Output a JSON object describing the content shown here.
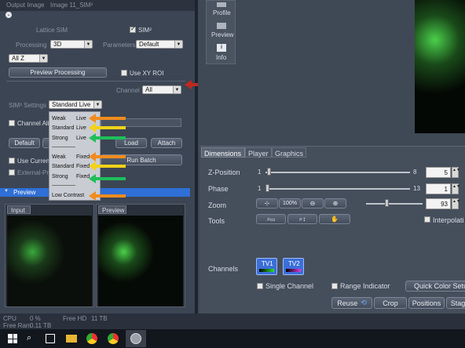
{
  "left_panel": {
    "output_image_label": "Output Image",
    "output_image_value": "Image 11_SIM²",
    "lattice_sim_label": "Lattice SIM",
    "sim2_check_label": "SIM²",
    "processing_label": "Processing",
    "processing_value": "3D",
    "parameters_label": "Parameters",
    "parameters_value": "Default",
    "z_select_value": "All Z",
    "preview_processing_button": "Preview Processing",
    "use_xy_roi_label": "Use XY ROI",
    "channel_label": "Channel",
    "channel_value": "All",
    "sim2_settings_label": "SIM² Settings",
    "sim2_settings_value": "Standard Live",
    "channel_align_label": "Channel Alig",
    "default_button": "Default",
    "load_button": "Load",
    "attach_button": "Attach",
    "use_current_label": "Use Current S",
    "run_batch_button": "Run Batch",
    "external_label": "External-Proc",
    "preview_section_title": "Preview",
    "input_tab": "Input",
    "preview_tab": "Preview",
    "status": {
      "cpu_label": "CPU",
      "cpu_value": "0 %",
      "free_hd_label": "Free HD",
      "free_hd_value": "11 TB",
      "free_ram_label": "Free Ram",
      "free_ram_value": "0.11 TB"
    }
  },
  "dropdown_options": [
    {
      "strength": "Weak",
      "mode": "Live"
    },
    {
      "strength": "Standard",
      "mode": "Live"
    },
    {
      "strength": "Strong",
      "mode": "Live"
    },
    {
      "strength": "Weak",
      "mode": "Fixed"
    },
    {
      "strength": "Standard",
      "mode": "Fixed"
    },
    {
      "strength": "Strong",
      "mode": "Fixed"
    },
    {
      "strength": "Low Contrast",
      "mode": ""
    }
  ],
  "side_nav": {
    "profile": "Profile",
    "preview": "Preview",
    "info": "Info"
  },
  "right_panel": {
    "tabs": [
      "Dimensions",
      "Player",
      "Graphics"
    ],
    "z_position_label": "Z-Position",
    "z_min": "1",
    "z_max": "8",
    "z_value": "5",
    "phase_label": "Phase",
    "phase_min": "1",
    "phase_max": "13",
    "phase_value": "1",
    "zoom_label": "Zoom",
    "zoom_100": "100%",
    "zoom_value": "93",
    "tools_label": "Tools",
    "interpolation_label": "Interpolati",
    "channels_label": "Channels",
    "tv1_label": "TV1",
    "tv2_label": "TV2",
    "single_channel_label": "Single Channel",
    "range_indicator_label": "Range Indicator",
    "quick_color_button": "Quick Color Setu",
    "reuse_button": "Reuse",
    "crop_button": "Crop",
    "positions_button": "Positions",
    "stage_button": "Stag"
  },
  "colors": {
    "arrow_red": "#c0281e",
    "arrow_orange": "#f08c1e",
    "arrow_yellow": "#f2d21a",
    "arrow_green": "#1fbf5a",
    "preview_header": "#2f6fd6"
  }
}
